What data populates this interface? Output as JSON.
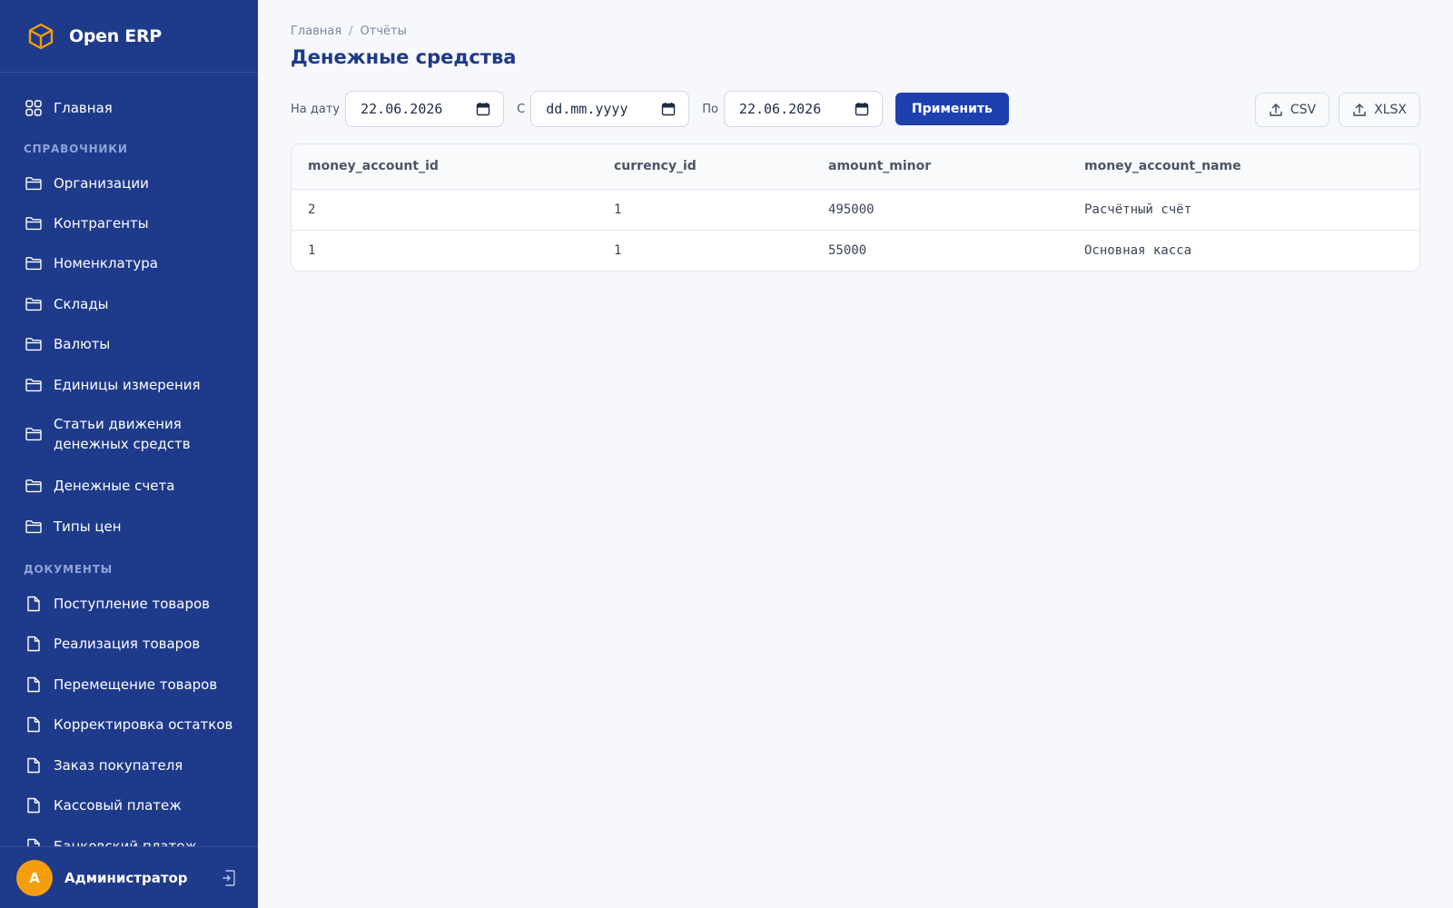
{
  "brand": {
    "name": "Open ERP",
    "logo_icon": "cube-icon",
    "accent": "#f59e0b"
  },
  "sidebar": {
    "main_item": {
      "label": "Главная",
      "icon": "grid-icon"
    },
    "sections": [
      {
        "title": "СПРАВОЧНИКИ",
        "items": [
          {
            "label": "Организации",
            "icon": "folder-icon"
          },
          {
            "label": "Контрагенты",
            "icon": "folder-icon"
          },
          {
            "label": "Номенклатура",
            "icon": "folder-icon"
          },
          {
            "label": "Склады",
            "icon": "folder-icon"
          },
          {
            "label": "Валюты",
            "icon": "folder-icon"
          },
          {
            "label": "Единицы измерения",
            "icon": "folder-icon"
          },
          {
            "label": "Статьи движения денежных средств",
            "icon": "folder-icon"
          },
          {
            "label": "Денежные счета",
            "icon": "folder-icon"
          },
          {
            "label": "Типы цен",
            "icon": "folder-icon"
          }
        ]
      },
      {
        "title": "ДОКУМЕНТЫ",
        "items": [
          {
            "label": "Поступление товаров",
            "icon": "document-icon"
          },
          {
            "label": "Реализация товаров",
            "icon": "document-icon"
          },
          {
            "label": "Перемещение товаров",
            "icon": "document-icon"
          },
          {
            "label": "Корректировка остатков",
            "icon": "document-icon"
          },
          {
            "label": "Заказ покупателя",
            "icon": "document-icon"
          },
          {
            "label": "Кассовый платеж",
            "icon": "document-icon"
          },
          {
            "label": "Банковский платеж",
            "icon": "document-icon"
          }
        ]
      }
    ],
    "user": {
      "initial": "А",
      "name": "Администратор"
    },
    "colors": {
      "background": "#1e3a8a",
      "section_title": "#8ea4d6"
    }
  },
  "breadcrumb": {
    "home": "Главная",
    "separator": "/",
    "current": "Отчёты"
  },
  "page_title": "Денежные средства",
  "filters": {
    "on_date_label": "На дату",
    "on_date_value": "22.06.2026",
    "from_label": "С",
    "from_value": "dd.mm.yyyy",
    "to_label": "По",
    "to_value": "22.06.2026",
    "apply_label": "Применить"
  },
  "exports": {
    "csv_label": "CSV",
    "xlsx_label": "XLSX"
  },
  "table": {
    "columns": [
      "money_account_id",
      "currency_id",
      "amount_minor",
      "money_account_name"
    ],
    "rows": [
      [
        "2",
        "1",
        "495000",
        "Расчётный счёт"
      ],
      [
        "1",
        "1",
        "55000",
        "Основная касса"
      ]
    ]
  }
}
